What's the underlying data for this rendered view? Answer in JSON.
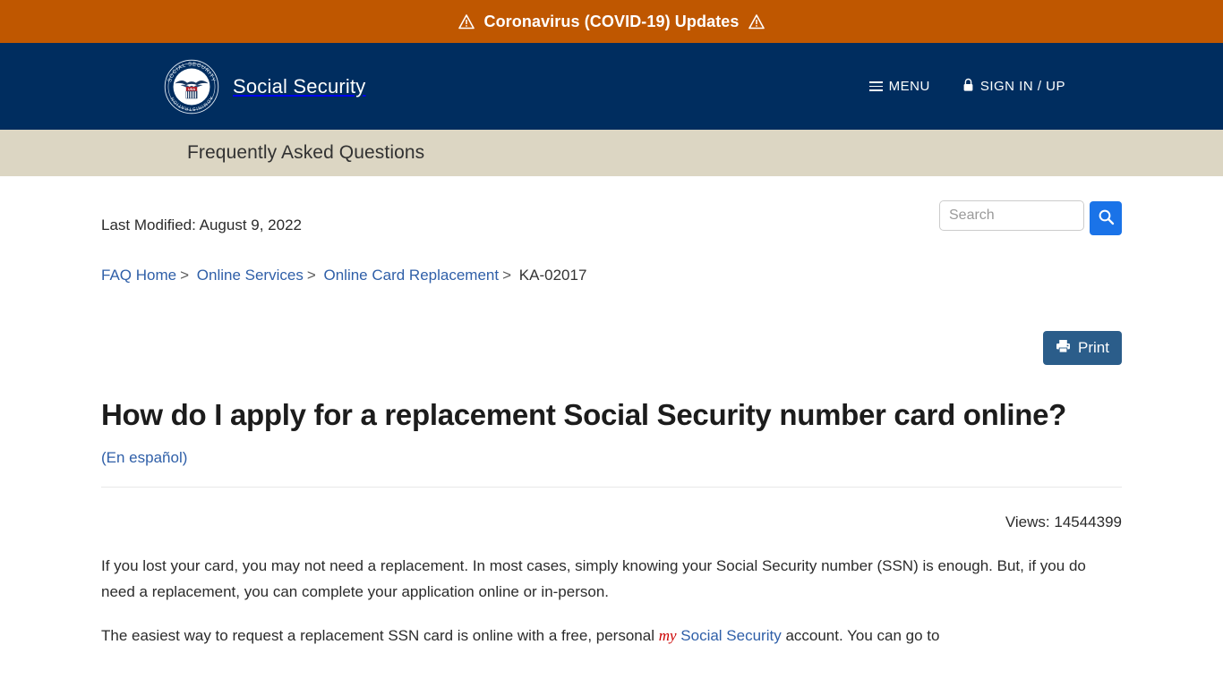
{
  "alert_banner": {
    "text": "Coronavirus (COVID-19) Updates",
    "left_icon": "warning-triangle-icon",
    "right_icon": "warning-triangle-icon",
    "background_color": "#bf5700"
  },
  "header": {
    "logo_alt": "Social Security Administration seal",
    "brand_name": "Social Security",
    "seal_text_top": "SOCIAL SECURITY",
    "seal_text_bottom": "ADMINISTRATION",
    "seal_shield_label": "USA",
    "menu_label": "MENU",
    "signin_label": "SIGN IN / UP",
    "background_color": "#002d5f"
  },
  "subheader": {
    "title": "Frequently Asked Questions",
    "background_color": "#dcd6c3"
  },
  "search": {
    "placeholder": "Search",
    "value": "",
    "button_icon": "search-icon",
    "button_color": "#1a73e8"
  },
  "meta": {
    "last_modified": "Last Modified: August 9, 2022",
    "views": "Views: 14544399"
  },
  "breadcrumb": {
    "items": [
      {
        "label": "FAQ Home",
        "is_link": true
      },
      {
        "label": "Online Services",
        "is_link": true
      },
      {
        "label": "Online Card Replacement",
        "is_link": true
      },
      {
        "label": "KA-02017",
        "is_link": false
      }
    ],
    "separator": ">"
  },
  "toolbar": {
    "print_label": "Print",
    "print_icon": "printer-icon",
    "print_color": "#2b5d8a"
  },
  "article": {
    "title": "How do I apply for a replacement Social Security number card online?",
    "spanish_link": "(En español)",
    "paragraph_1": "If you lost your card, you may not need a replacement. In most cases, simply knowing your Social Security number (SSN) is enough. But, if you do need a replacement, you can complete your application online or in-person.",
    "paragraph_2_part1": "The easiest way to request a replacement SSN card is online with a free, personal ",
    "paragraph_2_my": "my",
    "paragraph_2_ss": " Social Security",
    "paragraph_2_part2": " account. You can go to"
  }
}
